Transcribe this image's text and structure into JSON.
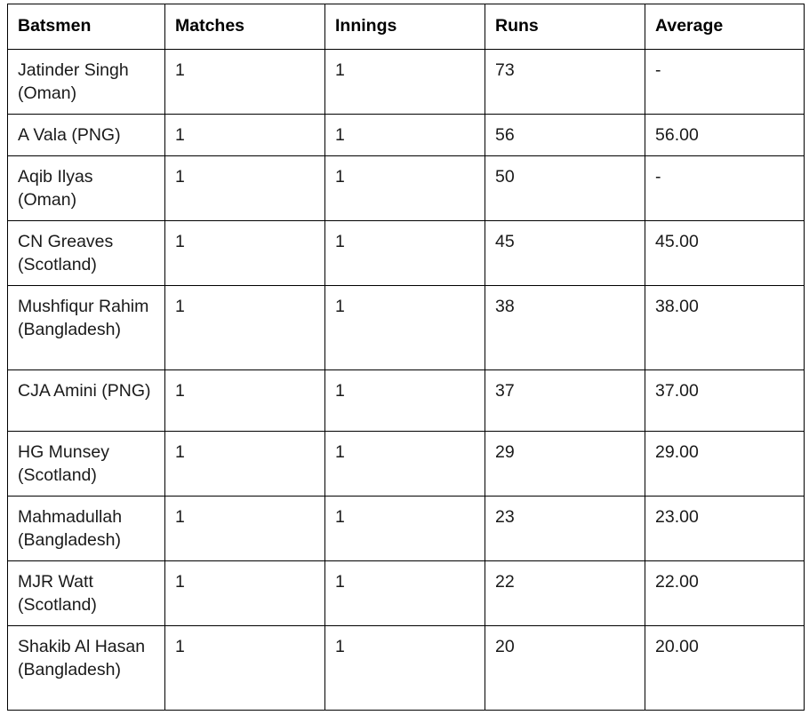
{
  "table": {
    "name": "batting-statistics-table",
    "columns": [
      {
        "key": "batsmen",
        "label": "Batsmen"
      },
      {
        "key": "matches",
        "label": "Matches"
      },
      {
        "key": "innings",
        "label": "Innings"
      },
      {
        "key": "runs",
        "label": "Runs"
      },
      {
        "key": "average",
        "label": "Average"
      }
    ],
    "rows": [
      {
        "batsmen": "Jatinder Singh (Oman)",
        "matches": "1",
        "innings": "1",
        "runs": "73",
        "average": "-",
        "lines": 2
      },
      {
        "batsmen": "A Vala (PNG)",
        "matches": "1",
        "innings": "1",
        "runs": "56",
        "average": "56.00",
        "lines": 1
      },
      {
        "batsmen": "Aqib Ilyas (Oman)",
        "matches": "1",
        "innings": "1",
        "runs": "50",
        "average": "-",
        "lines": 2
      },
      {
        "batsmen": "CN Greaves (Scotland)",
        "matches": "1",
        "innings": "1",
        "runs": "45",
        "average": "45.00",
        "lines": 2
      },
      {
        "batsmen": "Mushfiqur Rahim (Bangladesh)",
        "matches": "1",
        "innings": "1",
        "runs": "38",
        "average": "38.00",
        "lines": 3
      },
      {
        "batsmen": "CJA Amini (PNG)",
        "matches": "1",
        "innings": "1",
        "runs": "37",
        "average": "37.00",
        "lines": 2
      },
      {
        "batsmen": "HG Munsey (Scotland)",
        "matches": "1",
        "innings": "1",
        "runs": "29",
        "average": "29.00",
        "lines": 2
      },
      {
        "batsmen": "Mahmadullah (Bangladesh)",
        "matches": "1",
        "innings": "1",
        "runs": "23",
        "average": "23.00",
        "lines": 2
      },
      {
        "batsmen": "MJR Watt (Scotland)",
        "matches": "1",
        "innings": "1",
        "runs": "22",
        "average": "22.00",
        "lines": 2
      },
      {
        "batsmen": "Shakib Al Hasan (Bangladesh)",
        "matches": "1",
        "innings": "1",
        "runs": "20",
        "average": "20.00",
        "lines": 3
      }
    ]
  },
  "colors": {
    "border": "#000000",
    "text": "#1a1a1a",
    "header_text": "#000000",
    "background": "#ffffff"
  }
}
